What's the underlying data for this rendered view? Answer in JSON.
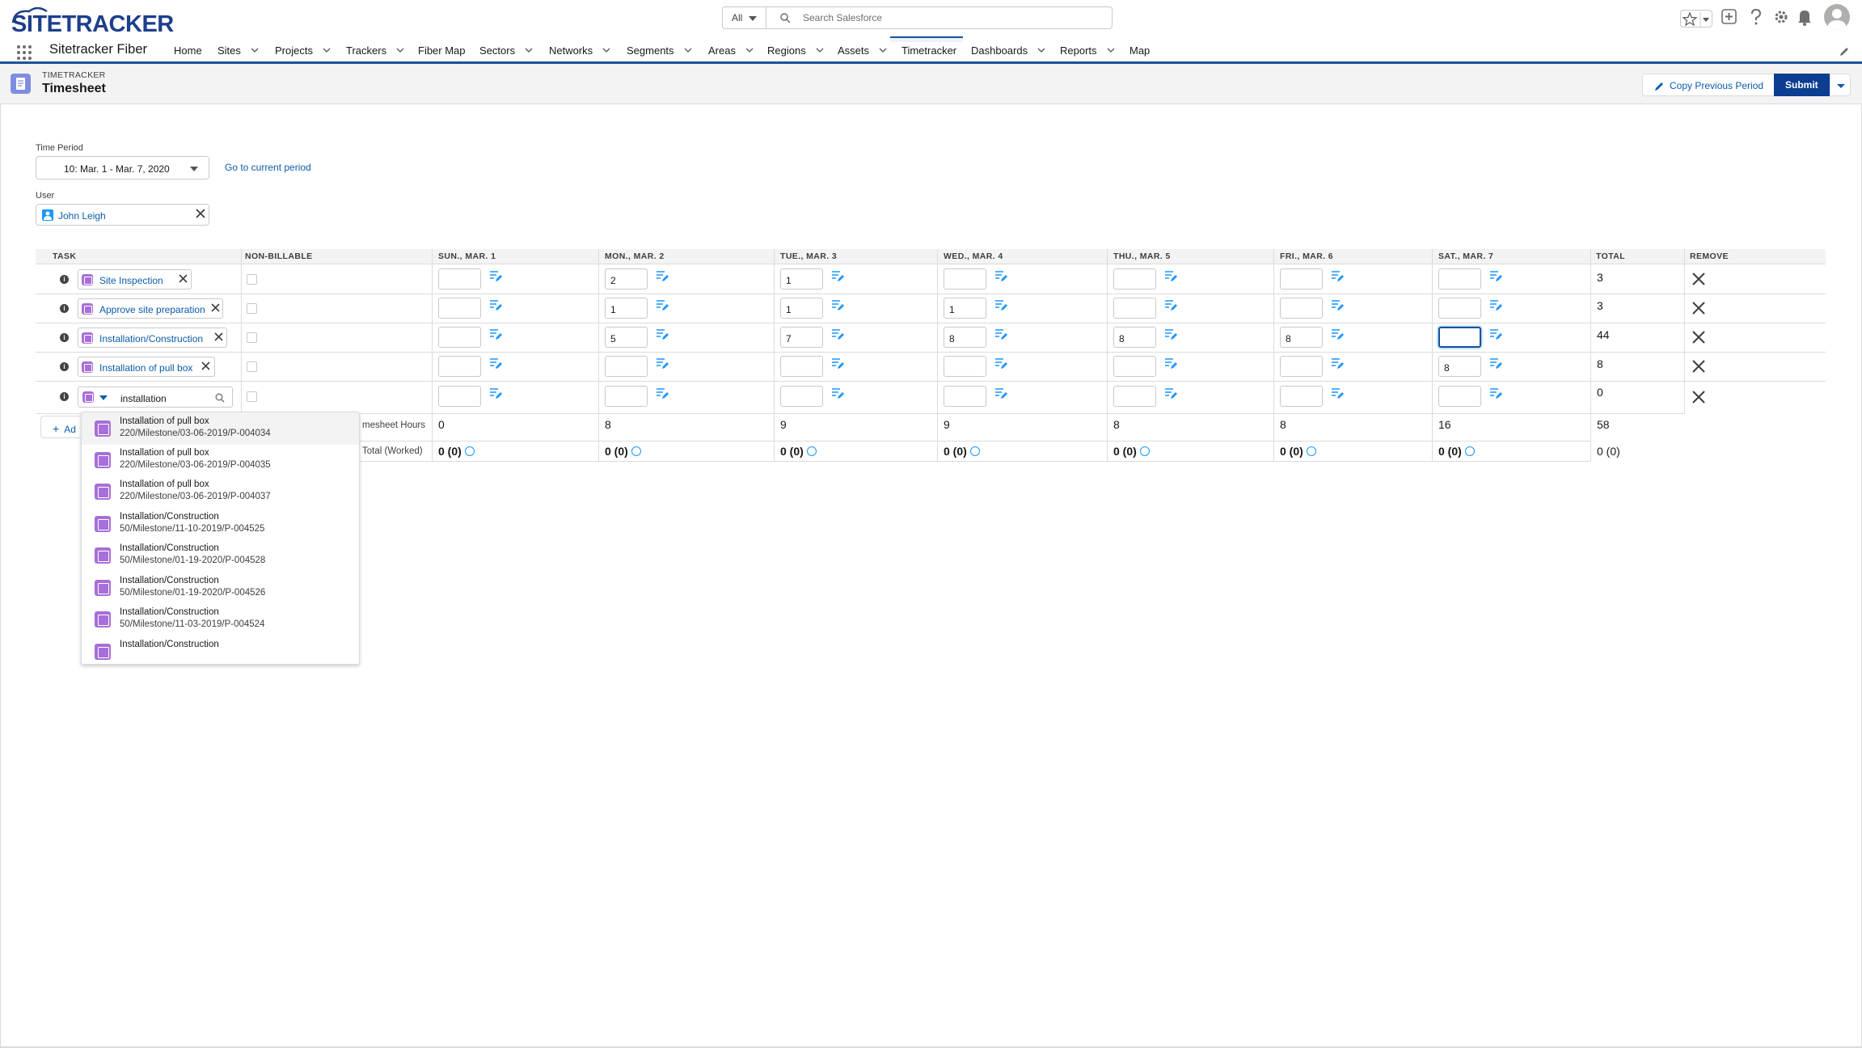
{
  "header": {
    "logo_text": "SITETRACKER",
    "search_scope": "All",
    "search_placeholder": "Search Salesforce"
  },
  "nav": {
    "app_name": "Sitetracker Fiber",
    "items": [
      {
        "label": "Home",
        "chevron": false
      },
      {
        "label": "Sites",
        "chevron": true
      },
      {
        "label": "Projects",
        "chevron": true
      },
      {
        "label": "Trackers",
        "chevron": true
      },
      {
        "label": "Fiber Map",
        "chevron": false
      },
      {
        "label": "Sectors",
        "chevron": true
      },
      {
        "label": "Networks",
        "chevron": true
      },
      {
        "label": "Segments",
        "chevron": true
      },
      {
        "label": "Areas",
        "chevron": true
      },
      {
        "label": "Regions",
        "chevron": true
      },
      {
        "label": "Assets",
        "chevron": true
      },
      {
        "label": "Timetracker",
        "chevron": false,
        "active": true
      },
      {
        "label": "Dashboards",
        "chevron": true
      },
      {
        "label": "Reports",
        "chevron": true
      },
      {
        "label": "Map",
        "chevron": false
      }
    ]
  },
  "page": {
    "eyebrow": "TIMETRACKER",
    "title": "Timesheet",
    "copy_button": "Copy Previous Period",
    "submit_button": "Submit"
  },
  "form": {
    "time_period_label": "Time Period",
    "time_period_value": "10: Mar. 1 - Mar. 7, 2020",
    "go_current_link": "Go to current period",
    "user_label": "User",
    "user_value": "John Leigh"
  },
  "grid": {
    "headers": [
      "TASK",
      "NON-BILLABLE",
      "SUN., MAR. 1",
      "MON., MAR. 2",
      "TUE., MAR. 3",
      "WED., MAR. 4",
      "THU., MAR. 5",
      "FRI., MAR. 6",
      "SAT., MAR. 7",
      "TOTAL",
      "REMOVE"
    ],
    "rows": [
      {
        "task": "Site Inspection",
        "hours": [
          "",
          "2",
          "1",
          "",
          "",
          "",
          ""
        ],
        "total": "3"
      },
      {
        "task": "Approve site preparation",
        "hours": [
          "",
          "1",
          "1",
          "1",
          "",
          "",
          ""
        ],
        "total": "3"
      },
      {
        "task": "Installation/Construction",
        "hours": [
          "",
          "5",
          "7",
          "8",
          "8",
          "8",
          ""
        ],
        "total": "44"
      },
      {
        "task": "Installation of pull box",
        "hours": [
          "",
          "",
          "",
          "",
          "",
          "",
          "8"
        ],
        "total": "8"
      },
      {
        "task": "",
        "hours": [
          "",
          "",
          "",
          "",
          "",
          "",
          ""
        ],
        "total": "0"
      }
    ],
    "search_value": "installation",
    "add_label": "Ad",
    "summary": {
      "hours_label": "mesheet Hours",
      "total_label": "Total (Worked)",
      "hours": [
        "0",
        "8",
        "9",
        "9",
        "8",
        "8",
        "16",
        "58"
      ],
      "worked": [
        "0 (0)",
        "0 (0)",
        "0 (0)",
        "0 (0)",
        "0 (0)",
        "0 (0)",
        "0 (0)",
        "0 (0)"
      ]
    }
  },
  "dropdown": {
    "items": [
      {
        "name": "Installation of pull box",
        "path": "220/Milestone/03-06-2019/P-004034"
      },
      {
        "name": "Installation of pull box",
        "path": "220/Milestone/03-06-2019/P-004035"
      },
      {
        "name": "Installation of pull box",
        "path": "220/Milestone/03-06-2019/P-004037"
      },
      {
        "name": "Installation/Construction",
        "path": "50/Milestone/11-10-2019/P-004525"
      },
      {
        "name": "Installation/Construction",
        "path": "50/Milestone/01-19-2020/P-004528"
      },
      {
        "name": "Installation/Construction",
        "path": "50/Milestone/01-19-2020/P-004526"
      },
      {
        "name": "Installation/Construction",
        "path": "50/Milestone/11-03-2019/P-004524"
      },
      {
        "name": "Installation/Construction",
        "path": ""
      }
    ]
  },
  "colors": {
    "brand": "#1d3f8c",
    "accent": "#1b5297",
    "link": "#0b5cab",
    "task_icon": "#a86ed9",
    "submit_bg": "#0b3d91"
  }
}
